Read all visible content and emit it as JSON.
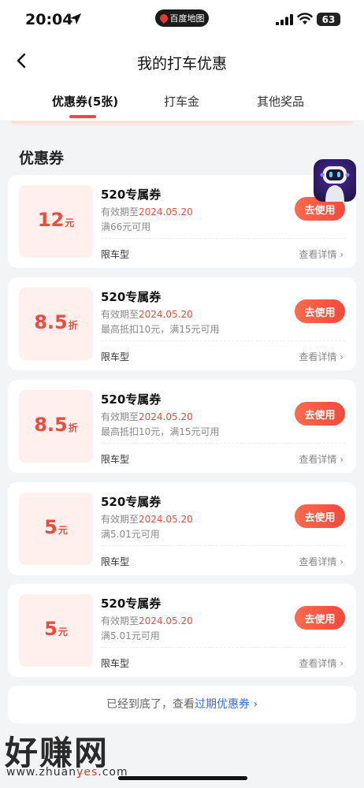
{
  "status_bar": {
    "time": "20:04",
    "app_pill": "百度地图",
    "battery": "63"
  },
  "header": {
    "title": "我的打车优惠"
  },
  "tabs": [
    {
      "label": "优惠券(5张)",
      "active": true
    },
    {
      "label": "打车金",
      "active": false
    },
    {
      "label": "其他奖品",
      "active": false
    }
  ],
  "section": {
    "title": "优惠券"
  },
  "coupons": [
    {
      "amount": "12",
      "unit": "元",
      "name": "520专属券",
      "expiry_prefix": "有效期至",
      "expiry_date": "2024.05.20",
      "condition": "满66元可用",
      "limit": "限车型",
      "detail": "查看详情 ›",
      "button": "去使用"
    },
    {
      "amount": "8.5",
      "unit": "折",
      "name": "520专属券",
      "expiry_prefix": "有效期至",
      "expiry_date": "2024.05.20",
      "condition": "最高抵扣10元，满15元可用",
      "limit": "限车型",
      "detail": "查看详情 ›",
      "button": "去使用"
    },
    {
      "amount": "8.5",
      "unit": "折",
      "name": "520专属券",
      "expiry_prefix": "有效期至",
      "expiry_date": "2024.05.20",
      "condition": "最高抵扣10元，满15元可用",
      "limit": "限车型",
      "detail": "查看详情 ›",
      "button": "去使用"
    },
    {
      "amount": "5",
      "unit": "元",
      "name": "520专属券",
      "expiry_prefix": "有效期至",
      "expiry_date": "2024.05.20",
      "condition": "满5.01元可用",
      "limit": "限车型",
      "detail": "查看详情 ›",
      "button": "去使用"
    },
    {
      "amount": "5",
      "unit": "元",
      "name": "520专属券",
      "expiry_prefix": "有效期至",
      "expiry_date": "2024.05.20",
      "condition": "满5.01元可用",
      "limit": "限车型",
      "detail": "查看详情 ›",
      "button": "去使用"
    }
  ],
  "footer": {
    "text": "已经到底了，查看",
    "link": "过期优惠券 ›"
  },
  "watermark": {
    "big": "好赚网",
    "url_prefix": "www.zhuan",
    "url_accent": "yes",
    "url_suffix": ".com"
  },
  "colors": {
    "accent": "#f04a3c",
    "link": "#2f6cf5"
  }
}
